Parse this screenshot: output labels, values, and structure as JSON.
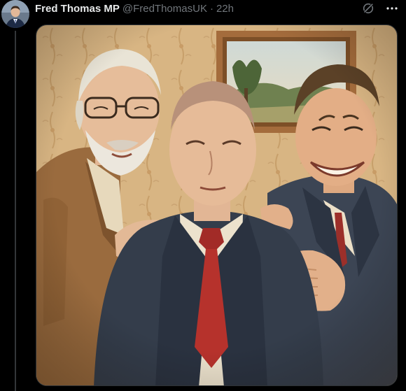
{
  "post": {
    "author": {
      "display_name": "Fred Thomas MP",
      "handle": "@FredThomasUK",
      "separator": "·",
      "timestamp": "22h",
      "avatar_icon": "profile-photo"
    },
    "actions": {
      "grok_icon": "grok-icon",
      "more_icon": "more-dots-icon"
    },
    "media": {
      "kind": "illustration",
      "description_icon": "painted-portrait-three-men"
    }
  },
  "colors": {
    "background": "#000000",
    "text_primary": "#e7e9ea",
    "text_secondary": "#71767b",
    "border": "#2f3336",
    "wallpaper": "#d9b98a",
    "frame": "#a46c3c"
  }
}
